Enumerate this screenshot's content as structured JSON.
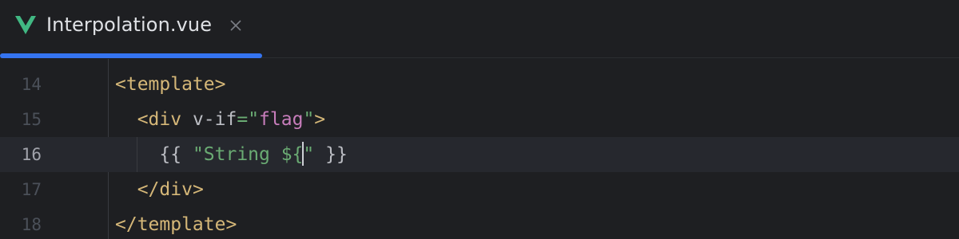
{
  "tab": {
    "title": "Interpolation.vue",
    "icon": "vue-logo-icon",
    "close_icon": "close-icon",
    "accent_color": "#3574f0"
  },
  "editor": {
    "current_line": 16,
    "lines": [
      {
        "number": "14",
        "tokens": [
          {
            "t": "<template>",
            "k": "tag"
          }
        ]
      },
      {
        "number": "15",
        "tokens": [
          {
            "t": "  ",
            "k": "plain"
          },
          {
            "t": "<div",
            "k": "tag"
          },
          {
            "t": " v-if",
            "k": "attr"
          },
          {
            "t": "=\"",
            "k": "str"
          },
          {
            "t": "flag",
            "k": "val"
          },
          {
            "t": "\"",
            "k": "str"
          },
          {
            "t": ">",
            "k": "tag"
          }
        ]
      },
      {
        "number": "16",
        "tokens": [
          {
            "t": "    {{ ",
            "k": "plain"
          },
          {
            "t": "\"String ${",
            "k": "str"
          },
          {
            "t": "\"",
            "k": "str"
          },
          {
            "t": " }}",
            "k": "plain"
          }
        ]
      },
      {
        "number": "17",
        "tokens": [
          {
            "t": "  ",
            "k": "plain"
          },
          {
            "t": "</div>",
            "k": "tag"
          }
        ]
      },
      {
        "number": "18",
        "tokens": [
          {
            "t": "</template>",
            "k": "tag"
          }
        ]
      }
    ]
  }
}
